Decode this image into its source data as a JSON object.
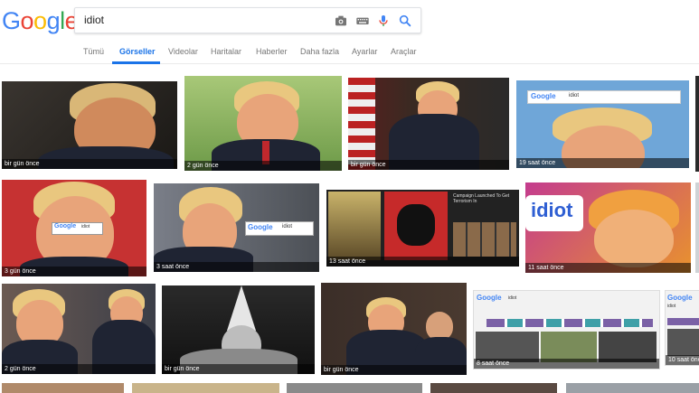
{
  "logo": {
    "letters": [
      "G",
      "o",
      "o",
      "g",
      "l",
      "e"
    ],
    "colors": [
      "#4285f4",
      "#ea4335",
      "#fbbc05",
      "#4285f4",
      "#34a853",
      "#ea4335"
    ]
  },
  "search": {
    "value": "idiot",
    "icons": [
      "camera-icon",
      "keyboard-icon",
      "microphone-icon",
      "search-icon"
    ]
  },
  "tabs": [
    {
      "label": "Tümü"
    },
    {
      "label": "Görseller",
      "active": true
    },
    {
      "label": "Videolar"
    },
    {
      "label": "Haritalar"
    },
    {
      "label": "Haberler"
    },
    {
      "label": "Daha fazla"
    },
    {
      "label": "Ayarlar"
    },
    {
      "label": "Araçlar"
    }
  ],
  "accent": "#1a73e8",
  "results": [
    {
      "caption": "bir gün önce"
    },
    {
      "caption": "2 gün önce"
    },
    {
      "caption": "bir gün önce"
    },
    {
      "caption": "19 saat önce",
      "overlay": "idiot"
    },
    {
      "caption": "3 gün önce",
      "overlay": "idiot"
    },
    {
      "caption": "3 saat önce",
      "overlay": "idiot"
    },
    {
      "caption": "13 saat önce",
      "overlay": "Campaign Launched To Get Terrorism In"
    },
    {
      "caption": "11 saat önce",
      "overlay": "idiot"
    },
    {
      "caption": "2 gün önce"
    },
    {
      "caption": "bir gün önce"
    },
    {
      "caption": "bir gün önce"
    },
    {
      "caption": "8 saat önce",
      "overlay": "idiot"
    },
    {
      "caption": "10 saat önce",
      "overlay": "idiot"
    }
  ]
}
